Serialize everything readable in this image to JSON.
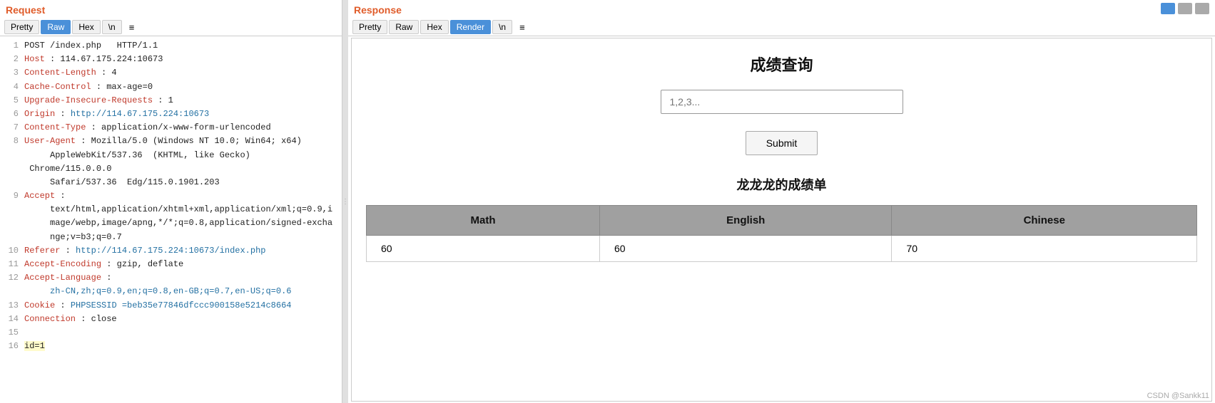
{
  "request": {
    "title": "Request",
    "tabs": [
      {
        "label": "Pretty",
        "active": false
      },
      {
        "label": "Raw",
        "active": true
      },
      {
        "label": "Hex",
        "active": false
      },
      {
        "label": "\\n",
        "active": false
      },
      {
        "label": "≡",
        "active": false,
        "plain": true
      }
    ],
    "lines": [
      {
        "num": 1,
        "text": "POST /index.php  HTTP/1.1"
      },
      {
        "num": 2,
        "text": "Host : 114.67.175.224:10673"
      },
      {
        "num": 3,
        "text": "Content-Length : 4"
      },
      {
        "num": 4,
        "text": "Cache-Control : max-age=0"
      },
      {
        "num": 5,
        "text": "Upgrade-Insecure-Requests : 1"
      },
      {
        "num": 6,
        "text": "Origin : http://114.67.175.224:10673"
      },
      {
        "num": 7,
        "text": "Content-Type : application/x-www-form-urlencoded"
      },
      {
        "num": 8,
        "text": "User-Agent : Mozilla/5.0 (Windows NT 10.0; Win64; x64) AppleWebKit/537.36  (KHTML, like Gecko)  Chrome/115.0.0.0 Safari/537.36  Edg/115.0.1901.203"
      },
      {
        "num": 9,
        "text": "Accept : text/html,application/xhtml+xml,application/xml;q=0.9,image/webp,image/apng,*/*;q=0.8,application/signed-exchange;v=b3;q=0.7"
      },
      {
        "num": 10,
        "text": "Referer : http://114.67.175.224:10673/index.php"
      },
      {
        "num": 11,
        "text": "Accept-Encoding : gzip, deflate"
      },
      {
        "num": 12,
        "text": "Accept-Language : zh-CN,zh;q=0.9,en;q=0.8,en-GB;q=0.7,en-US;q=0.6"
      },
      {
        "num": 13,
        "text": "Cookie : PHPSESSID =beb35e77846dfccc900158e5214c8664"
      },
      {
        "num": 14,
        "text": "Connection : close"
      },
      {
        "num": 15,
        "text": ""
      },
      {
        "num": 16,
        "text": "id=1"
      }
    ]
  },
  "response": {
    "title": "Response",
    "tabs": [
      {
        "label": "Pretty",
        "active": false
      },
      {
        "label": "Raw",
        "active": false
      },
      {
        "label": "Hex",
        "active": false
      },
      {
        "label": "Render",
        "active": true
      },
      {
        "label": "\\n",
        "active": false
      },
      {
        "label": "≡",
        "active": false,
        "plain": true
      }
    ],
    "render": {
      "page_title": "成绩查询",
      "input_placeholder": "1,2,3...",
      "submit_label": "Submit",
      "result_title": "龙龙龙的成绩单",
      "table": {
        "headers": [
          "Math",
          "English",
          "Chinese"
        ],
        "rows": [
          [
            "60",
            "60",
            "70"
          ]
        ]
      }
    }
  },
  "watermark": "CSDN @Sankk11"
}
